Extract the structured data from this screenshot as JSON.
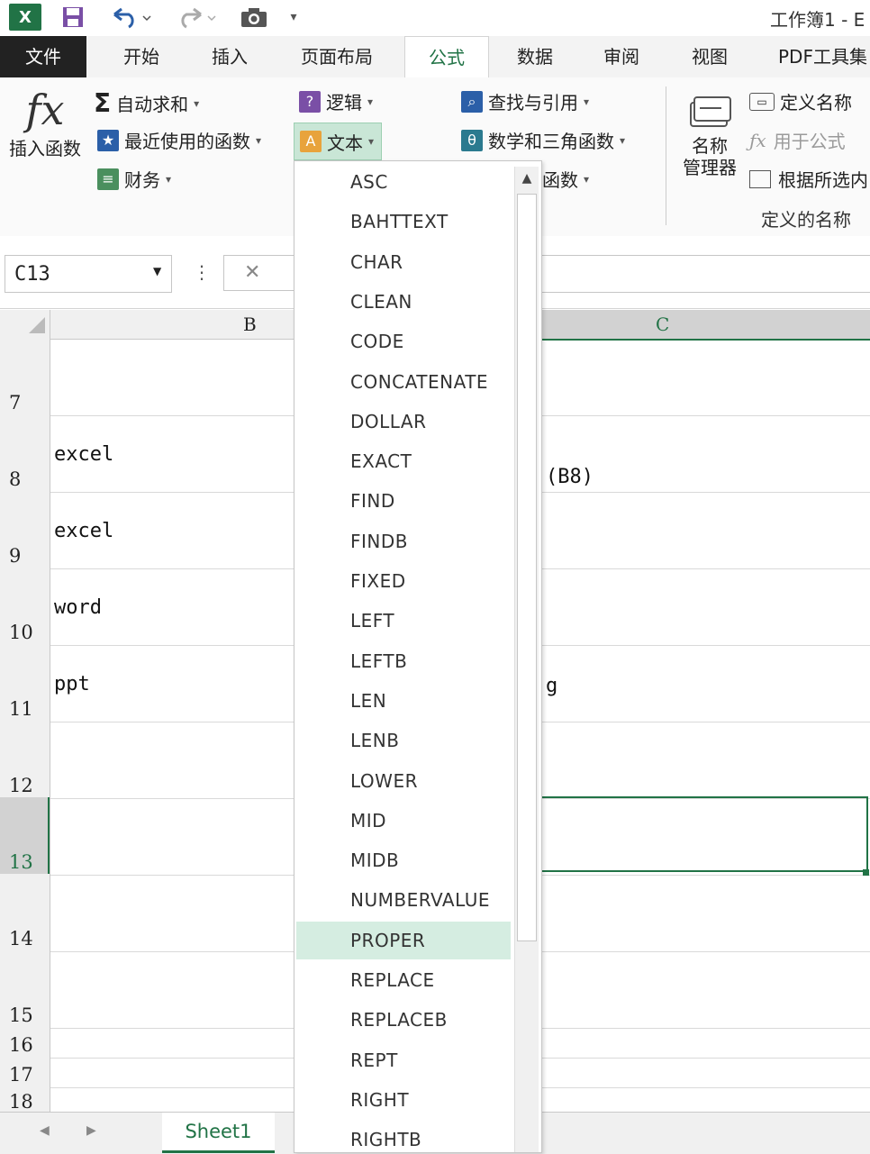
{
  "window": {
    "title": "工作簿1 - E"
  },
  "quick_access": {
    "excel_logo": "X",
    "save_icon": "save-icon",
    "undo_icon": "undo-icon",
    "redo_icon": "redo-icon",
    "camera_icon": "camera-icon"
  },
  "tabs": [
    {
      "label": "文件"
    },
    {
      "label": "开始"
    },
    {
      "label": "插入"
    },
    {
      "label": "页面布局"
    },
    {
      "label": "公式"
    },
    {
      "label": "数据"
    },
    {
      "label": "审阅"
    },
    {
      "label": "视图"
    },
    {
      "label": "PDF工具集"
    }
  ],
  "ribbon": {
    "insert_function": {
      "glyph": "fx",
      "label": "插入函数"
    },
    "autosum": "自动求和",
    "recent": "最近使用的函数",
    "finance": "财务",
    "logic": "逻辑",
    "text": "文本",
    "lookup": "查找与引用",
    "math": "数学和三角函数",
    "more": "函数",
    "name_manager_line1": "名称",
    "name_manager_line2": "管理器",
    "define_name": "定义名称",
    "use_in_formula": "用于公式",
    "create_from_selection": "根据所选内",
    "group_label": "定义的名称"
  },
  "formula_bar": {
    "name_box": "C13",
    "cancel": "✕",
    "dots": "⋮"
  },
  "columns": {
    "b": "B",
    "c": "C"
  },
  "rows": [
    "7",
    "8",
    "9",
    "10",
    "11",
    "12",
    "13",
    "14",
    "15",
    "16",
    "17",
    "18"
  ],
  "cells": {
    "b8": "excel",
    "b9": "excel",
    "b10": "word",
    "b11": "ppt",
    "c8": "(B8)",
    "c11": "g"
  },
  "sheet": {
    "tab": "Sheet1"
  },
  "dropdown": {
    "items": [
      "ASC",
      "BAHTTEXT",
      "CHAR",
      "CLEAN",
      "CODE",
      "CONCATENATE",
      "DOLLAR",
      "EXACT",
      "FIND",
      "FINDB",
      "FIXED",
      "LEFT",
      "LEFTB",
      "LEN",
      "LENB",
      "LOWER",
      "MID",
      "MIDB",
      "NUMBERVALUE",
      "PROPER",
      "REPLACE",
      "REPLACEB",
      "REPT",
      "RIGHT",
      "RIGHTB"
    ],
    "highlighted": "PROPER"
  },
  "colors": {
    "accent": "#217346",
    "highlight": "#d5ede1",
    "file_tab": "#222222"
  }
}
